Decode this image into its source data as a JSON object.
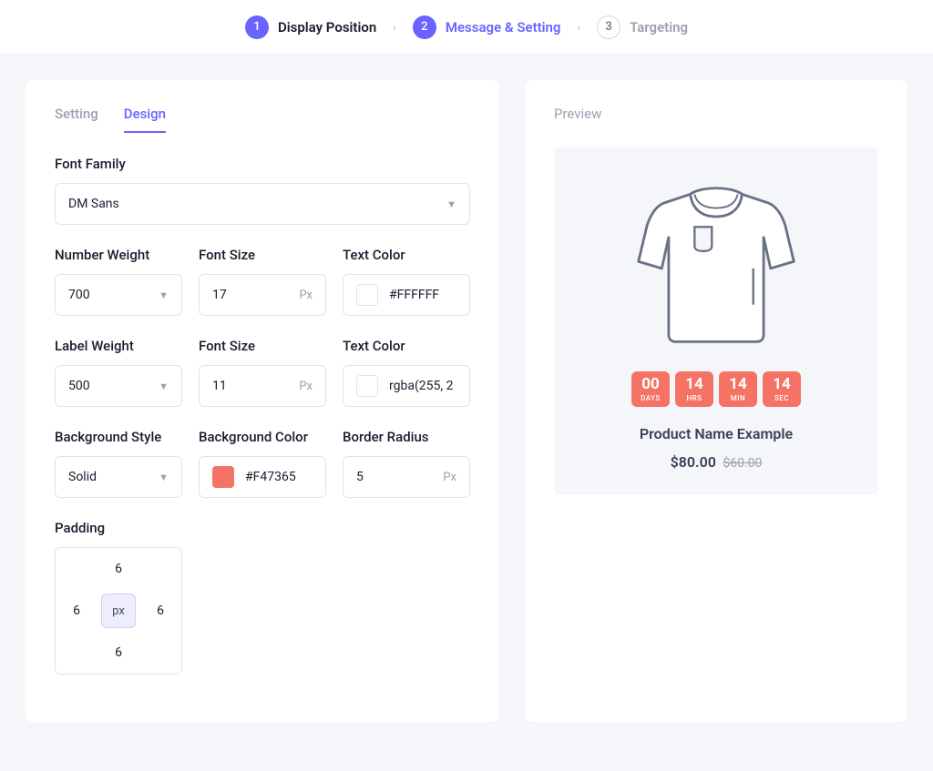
{
  "stepper": {
    "steps": [
      {
        "num": "1",
        "label": "Display Position",
        "state": "completed"
      },
      {
        "num": "2",
        "label": "Message & Setting",
        "state": "current"
      },
      {
        "num": "3",
        "label": "Targeting",
        "state": "pending"
      }
    ]
  },
  "tabs": {
    "setting": "Setting",
    "design": "Design",
    "active": "design"
  },
  "preview_label": "Preview",
  "fields": {
    "font_family": {
      "label": "Font Family",
      "value": "DM Sans"
    },
    "number_weight": {
      "label": "Number Weight",
      "value": "700"
    },
    "number_font_size": {
      "label": "Font Size",
      "value": "17",
      "unit": "Px"
    },
    "number_text_color": {
      "label": "Text Color",
      "value": "#FFFFFF"
    },
    "label_weight": {
      "label": "Label Weight",
      "value": "500"
    },
    "label_font_size": {
      "label": "Font Size",
      "value": "11",
      "unit": "Px"
    },
    "label_text_color": {
      "label": "Text Color",
      "value": "rgba(255, 2"
    },
    "bg_style": {
      "label": "Background Style",
      "value": "Solid"
    },
    "bg_color": {
      "label": "Background Color",
      "value": "#F47365"
    },
    "border_radius": {
      "label": "Border Radius",
      "value": "5",
      "unit": "Px"
    },
    "padding": {
      "label": "Padding",
      "top": "6",
      "right": "6",
      "bottom": "6",
      "left": "6",
      "unit": "px"
    }
  },
  "preview": {
    "countdown": [
      {
        "num": "00",
        "label": "DAYS"
      },
      {
        "num": "14",
        "label": "HRS"
      },
      {
        "num": "14",
        "label": "MIN"
      },
      {
        "num": "14",
        "label": "SEC"
      }
    ],
    "product_name": "Product Name Example",
    "price": "$80.00",
    "old_price": "$60.00"
  },
  "colors": {
    "accent": "#6b63ff",
    "countdown_bg": "#f47365"
  }
}
